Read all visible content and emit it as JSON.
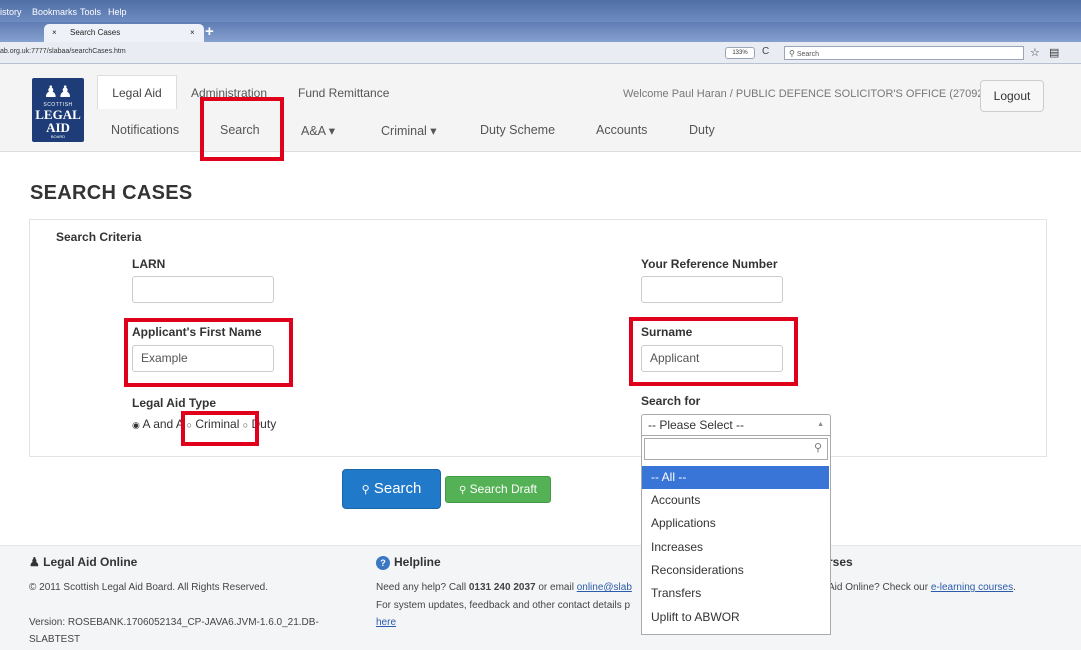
{
  "browser": {
    "menu": [
      "istory",
      "Bookmarks",
      "Tools",
      "Help"
    ],
    "tab_title": "Search Cases",
    "tab_close": "×",
    "new_tab": "+",
    "url": "ab.org.uk:7777/slabaa/searchCases.htm",
    "zoom": "133%",
    "reload": "C",
    "search_placeholder": "Search"
  },
  "header": {
    "logo": {
      "small": "SCOTTISH",
      "big_line1": "LEGAL",
      "big_line2": "AID",
      "bottom": "BOARD"
    },
    "tabs": [
      "Legal Aid",
      "Administration",
      "Fund Remittance"
    ],
    "nav": [
      "Notifications",
      "Search",
      "A&A ▾",
      "Criminal ▾",
      "Duty Scheme",
      "Accounts",
      "Duty"
    ],
    "welcome": "Welcome Paul Haran / PUBLIC DEFENCE SOLICITOR'S OFFICE (27092)",
    "logout": "Logout"
  },
  "page": {
    "title": "SEARCH CASES",
    "criteria": "Search Criteria",
    "larn_label": "LARN",
    "larn_value": "",
    "ref_label": "Your Reference Number",
    "ref_value": "",
    "first_name_label": "Applicant's First Name",
    "first_name_value": "Example",
    "surname_label": "Surname",
    "surname_value": "Applicant",
    "legal_aid_type_label": "Legal Aid Type",
    "legal_aid_types": [
      "A and A",
      "Criminal",
      "Duty"
    ],
    "search_for_label": "Search for",
    "search_for_selected": "-- Please Select --",
    "search_for_options": [
      "-- All --",
      "Accounts",
      "Applications",
      "Increases",
      "Reconsiderations",
      "Transfers",
      "Uplift to ABWOR"
    ],
    "search_button": "Search",
    "draft_button": "Search Draft"
  },
  "footer": {
    "col1_title": "Legal Aid Online",
    "col1_copy": "© 2011 Scottish Legal Aid Board. All Rights Reserved.",
    "col1_version": "Version: ROSEBANK.1706052134_CP-JAVA6.JVM-1.6.0_21.DB-",
    "col1_version2": "SLABTEST",
    "col2_title": "Helpline",
    "col2_line1_a": "Need any help? Call ",
    "col2_phone": "0131 240 2037",
    "col2_line1_b": " or email ",
    "col2_email": "online@slab",
    "col2_line2": "For system updates, feedback and other contact details p",
    "col2_here": "here",
    "col3_title": "rses",
    "col3_text": "Aid Online? Check our ",
    "col3_link": "e-learning courses",
    "col3_end": "."
  }
}
